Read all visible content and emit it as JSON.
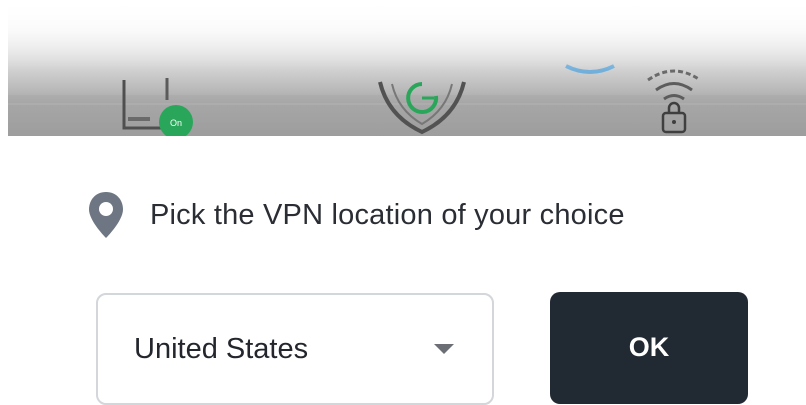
{
  "banner": {
    "icons": [
      "router-icon",
      "shield-icon",
      "wifi-lock-icon"
    ],
    "router_badge_label": "On",
    "accent_color": "#2aa65a"
  },
  "prompt": {
    "icon": "location-pin-icon",
    "text": "Pick the VPN location of your choice"
  },
  "location_select": {
    "value": "United States"
  },
  "ok_button": {
    "label": "OK"
  },
  "colors": {
    "button_bg": "#212933",
    "button_text": "#ffffff",
    "select_border": "#d3d6da",
    "pin_color": "#6d7682"
  }
}
